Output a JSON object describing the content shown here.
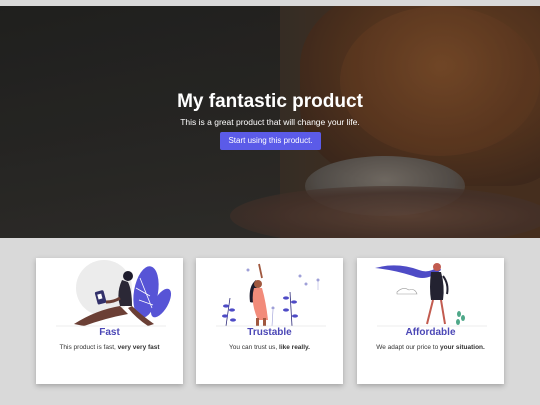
{
  "hero": {
    "title": "My fantastic product",
    "subtitle": "This is a great product that will change your life.",
    "cta_label": "Start using this product."
  },
  "features": [
    {
      "title": "Fast",
      "text_plain": "This product is fast, ",
      "text_bold": "very very fast",
      "illustration": "woman-with-phone-illustration"
    },
    {
      "title": "Trustable",
      "text_plain": "You can trust us, ",
      "text_bold": "like really.",
      "illustration": "woman-celebrating-illustration"
    },
    {
      "title": "Affordable",
      "text_plain": "We adapt our price to ",
      "text_bold": "your situation.",
      "illustration": "woman-with-umbrella-illustration"
    }
  ],
  "colors": {
    "accent": "#5b5be8",
    "feature_title": "#4b47b6",
    "page_bg": "#d9d9d9"
  }
}
